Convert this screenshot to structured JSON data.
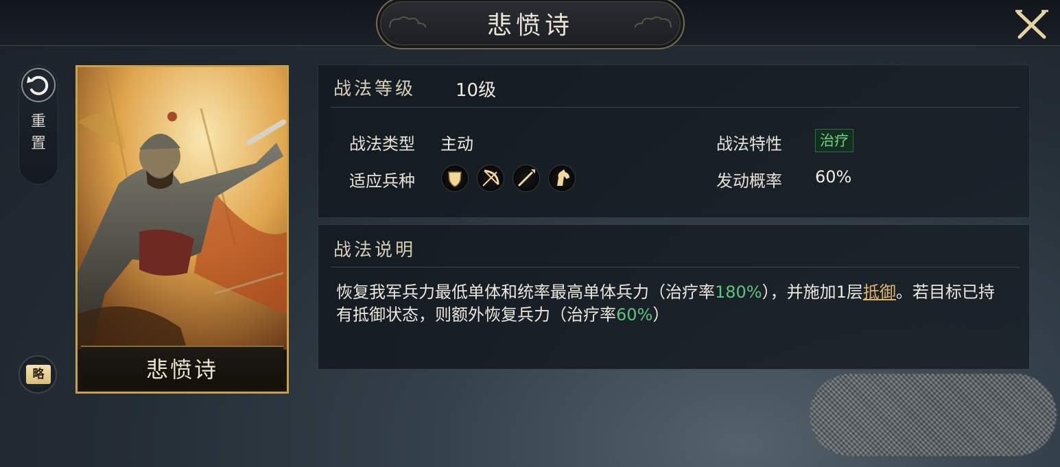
{
  "header": {
    "title": "悲愤诗"
  },
  "sidebar": {
    "reset_label": "重\n置",
    "brief_label": "略"
  },
  "card": {
    "name": "悲愤诗"
  },
  "info": {
    "level_label": "战法等级",
    "level_value": "10级",
    "type_label": "战法类型",
    "type_value": "主动",
    "trait_label": "战法特性",
    "trait_value": "治疗",
    "troops_label": "适应兵种",
    "troop_icons": [
      "shield-icon",
      "bow-icon",
      "spear-icon",
      "horse-icon"
    ],
    "chance_label": "发动概率",
    "chance_value": "60%"
  },
  "description": {
    "heading": "战法说明",
    "part1": "恢复我军兵力最低单体和统率最高单体兵力（治疗率",
    "rate1": "180%",
    "part2": "），并施加1层",
    "link": "抵御",
    "part3": "。若目标已持有抵御状态，则额外恢复兵力（治疗率",
    "rate2": "60%",
    "part4": "）"
  },
  "colors": {
    "accent_gold": "#c8a14a",
    "heal_green": "#5fc47e",
    "link_orange": "#e0b46a"
  }
}
